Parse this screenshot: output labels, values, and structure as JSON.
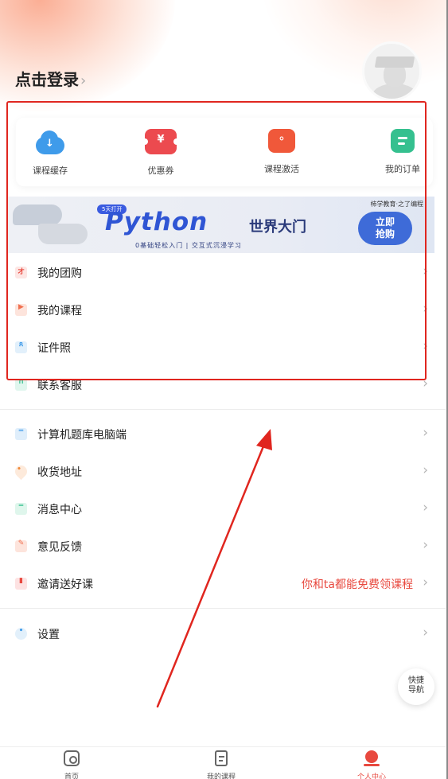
{
  "header": {
    "login_text": "点击登录",
    "chevron": "›"
  },
  "shortcuts": [
    {
      "label": "课程缓存",
      "icon": "cloud-download-icon"
    },
    {
      "label": "优惠券",
      "icon": "coupon-icon"
    },
    {
      "label": "课程激活",
      "icon": "activate-icon"
    },
    {
      "label": "我的订单",
      "icon": "order-icon"
    }
  ],
  "banner": {
    "badge": "5天打开",
    "brand": "柿学教育·之了编程",
    "title": "Python",
    "subtitle_cn": "世界大门",
    "tagline": "0基础轻松入门 | 交互式沉浸学习",
    "cta_line1": "立即",
    "cta_line2": "抢购"
  },
  "menu_group1": [
    {
      "label": "我的团购",
      "icon": "group-buy-icon"
    },
    {
      "label": "我的课程",
      "icon": "course-icon"
    },
    {
      "label": "证件照",
      "icon": "id-photo-icon"
    },
    {
      "label": "联系客服",
      "icon": "customer-service-icon"
    }
  ],
  "menu_group2": [
    {
      "label": "计算机题库电脑端",
      "icon": "computer-icon",
      "note": ""
    },
    {
      "label": "收货地址",
      "icon": "location-icon",
      "note": ""
    },
    {
      "label": "消息中心",
      "icon": "message-icon",
      "note": ""
    },
    {
      "label": "意见反馈",
      "icon": "feedback-icon",
      "note": ""
    },
    {
      "label": "邀请送好课",
      "icon": "invite-icon",
      "note": "你和ta都能免费领课程"
    }
  ],
  "menu_group3": [
    {
      "label": "设置",
      "icon": "settings-icon"
    }
  ],
  "quick_nav": {
    "line1": "快捷",
    "line2": "导航"
  },
  "tabbar": [
    {
      "label": "首页",
      "icon": "home-icon",
      "active": false
    },
    {
      "label": "我的课程",
      "icon": "my-course-icon",
      "active": false
    },
    {
      "label": "个人中心",
      "icon": "profile-icon",
      "active": true
    }
  ],
  "colors": {
    "accent": "#e8493f",
    "annotation_red": "#e0261f",
    "invite_note": "#e8493f",
    "text": "#222222",
    "muted": "#666666"
  }
}
